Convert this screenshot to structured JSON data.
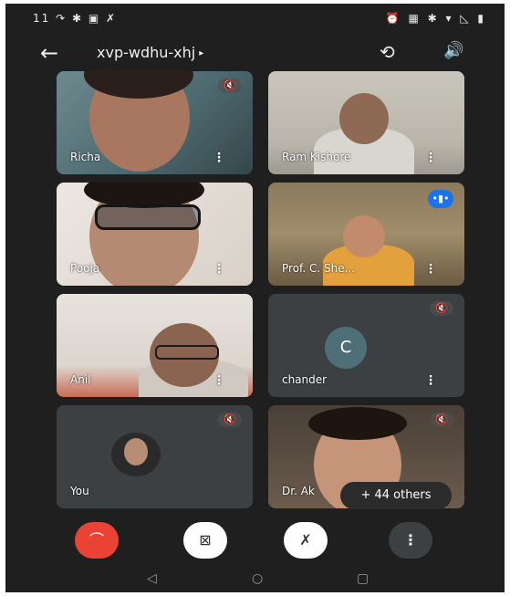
{
  "status": {
    "left": "11 ↷ ✱ ▣ ✗",
    "right": "⏰ ▦ ✱ ▾ ◺ ▮"
  },
  "header": {
    "back_icon": "←",
    "title": "xvp-wdhu-xhj",
    "caret": "▸",
    "camera_switch_icon": "⟲",
    "speaker_icon": "🔊"
  },
  "tiles": [
    {
      "name": "Richa",
      "muted": true,
      "more": "⋮"
    },
    {
      "name": "Ram Kishore",
      "muted": false,
      "more": "⋮"
    },
    {
      "name": "Pooja",
      "muted": false,
      "more": "⋮"
    },
    {
      "name": "Prof. C. She...",
      "speaking": true,
      "more": "⋮"
    },
    {
      "name": "Anil",
      "muted": false,
      "more": "⋮"
    },
    {
      "name": "chander",
      "muted": true,
      "avatar_letter": "C",
      "more": "⋮"
    },
    {
      "name": "You",
      "muted": true
    },
    {
      "name": "Dr. Ak",
      "muted": true
    }
  ],
  "others_badge": "+ 44 others",
  "mute_icon": "🔇",
  "speaking_icon": "•▮•",
  "controls": {
    "end_icon": "⌒",
    "camera_icon": "⊠",
    "mic_icon": "✗",
    "more_icon": "⋮"
  },
  "navbar": {
    "back": "◁",
    "home": "○",
    "recent": "▢"
  },
  "colors": {
    "end_call": "#ea4335",
    "speaking": "#1a73e8",
    "tile_bg": "#3c4043"
  }
}
